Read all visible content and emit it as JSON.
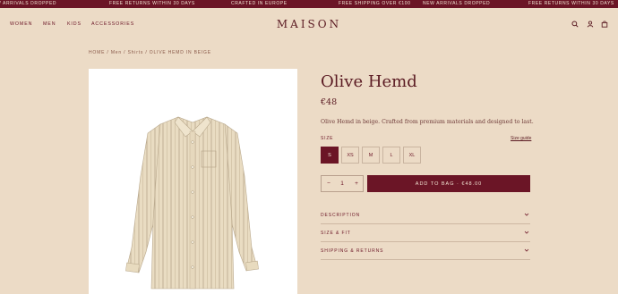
{
  "ticker": [
    "W ARRIVALS DROPPED",
    "FREE RETURNS WITHIN 30 DAYS",
    "CRAFTED IN EUROPE",
    "FREE SHIPPING OVER €100",
    "NEW ARRIVALS DROPPED",
    "FREE RETURNS WITHIN 30 DAYS"
  ],
  "nav": {
    "links": [
      "WOMEN",
      "MEN",
      "KIDS",
      "ACCESSORIES"
    ],
    "brand": "MAISON",
    "icons": [
      "search-icon",
      "account-icon",
      "bag-icon"
    ]
  },
  "breadcrumb": {
    "home": "HOME",
    "sep1": "/",
    "men": "Men",
    "sep2": "/",
    "shirts": "Shirts",
    "sep3": "/",
    "current": "OLIVE HEMD IN BEIGE"
  },
  "product": {
    "title": "Olive Hemd",
    "price": "€48",
    "description": "Olive Hemd in beige. Crafted from premium materials and designed to last.",
    "size_label": "SIZE",
    "size_guide": "Size guide",
    "sizes": [
      "S",
      "XS",
      "M",
      "L",
      "XL"
    ],
    "selected_size": "S",
    "qty_minus": "−",
    "qty_value": "1",
    "qty_plus": "+",
    "add_to_bag": "ADD TO BAG · €48.00"
  },
  "accordion": [
    "DESCRIPTION",
    "SIZE & FIT",
    "SHIPPING & RETURNS"
  ],
  "colors": {
    "background": "#ecdbc6",
    "accent": "#6b1526",
    "text": "#5a1a22"
  }
}
